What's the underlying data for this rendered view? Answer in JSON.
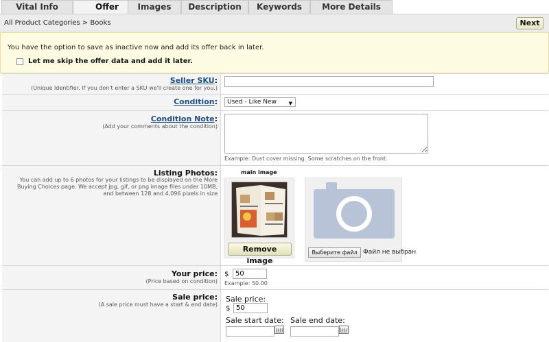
{
  "tabs": [
    {
      "label": "Vital Info",
      "active": false
    },
    {
      "label": "Offer",
      "active": true
    },
    {
      "label": "Images",
      "active": false
    },
    {
      "label": "Description",
      "active": false
    },
    {
      "label": "Keywords",
      "active": false
    },
    {
      "label": "More Details",
      "active": false
    }
  ],
  "breadcrumb": "All Product Categories > Books",
  "next_label": "Next",
  "info": {
    "message": "You have the option to save as inactive now and add its offer back in later.",
    "skip_label": "Let me skip the offer data and add it later.",
    "skip_checked": false
  },
  "seller_sku": {
    "label": "Seller SKU",
    "colon": ":",
    "sub": "(Unique Identifier. If you don't enter a SKU we'll create one for you.)",
    "value": ""
  },
  "condition": {
    "label": "Condition",
    "colon": ":",
    "selected": "Used - Like New"
  },
  "condition_note": {
    "label": "Condition Note",
    "colon": ":",
    "sub": "(Add your comments about the condition)",
    "value": "",
    "example": "Example: Dust cover missing. Some scratches on the front."
  },
  "photos": {
    "label": "Listing Photos:",
    "sub": "You can add up to 6 photos for your listings to be displayed on the More Buying Choices page. We accept jpg, gif, or png image files under 10MB, and between 128 and 4,096 pixels in size",
    "main_title": "main image",
    "remove_label": "Remove image",
    "choose_label": "Выберите файл",
    "file_status": "Файл не выбран"
  },
  "your_price": {
    "label": "Your price:",
    "sub": "(Price based on condition)",
    "currency": "$",
    "value": "50",
    "example": "Example: 50.00"
  },
  "sale_price": {
    "label": "Sale price:",
    "sub": "(A sale price must have a start & end date)",
    "inner_label": "Sale price:",
    "currency": "$",
    "value": "50",
    "start_label": "Sale start date:",
    "end_label": "Sale end date:",
    "start_value": "",
    "end_value": ""
  },
  "colors": {
    "tab_bg": "#e4e4e4",
    "info_bg": "#fdfbe2",
    "link": "#1e4f85",
    "button_bg": "#f1f2d4"
  }
}
